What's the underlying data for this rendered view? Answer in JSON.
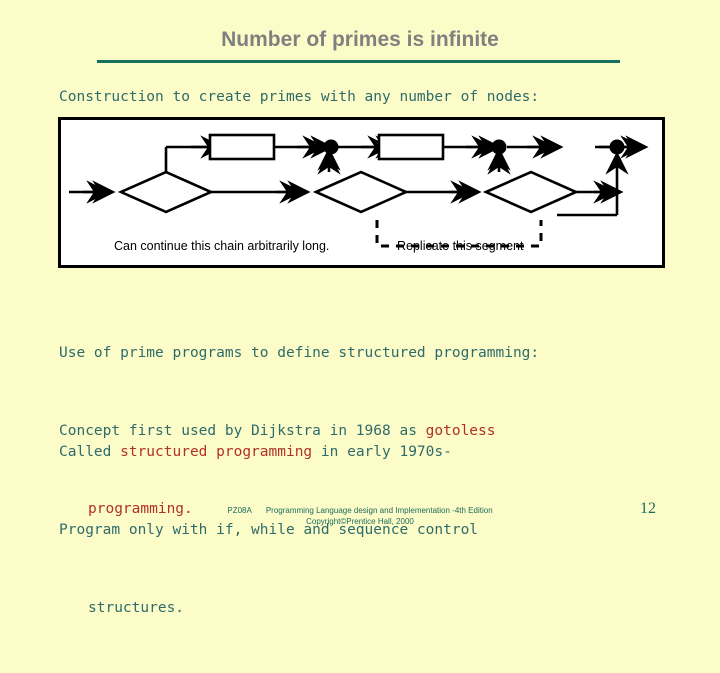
{
  "slide": {
    "title": "Number of primes is infinite",
    "lead": "Construction to create primes with any number of nodes:",
    "accent_rule_color": "#18705E",
    "title_color": "#808080",
    "background_color": "#FCFCC8",
    "body_text_color": "#2E6B6B",
    "highlight_color": "#B0302B"
  },
  "diagram": {
    "caption_left": "Can continue this chain arbitrarily long.",
    "caption_right": "Replicate this segment"
  },
  "block_a": {
    "line1": "Use of prime programs to define structured programming:",
    "line2_plain": "Concept first used by Dijkstra in 1968 as ",
    "line2_highlight": "gotoless",
    "line3_highlight": "programming."
  },
  "block_b": {
    "line1_plain_a": "Called ",
    "line1_highlight": "structured programming",
    "line1_plain_b": " in early 1970s-",
    "line2": "Program only with if, while and sequence control",
    "line3": "structures."
  },
  "footer": {
    "code": "PZ08A",
    "line1": "Programming Language design and Implementation -4th Edition",
    "line2": "Copyright©Prentice Hall, 2000",
    "page_number": "12"
  }
}
